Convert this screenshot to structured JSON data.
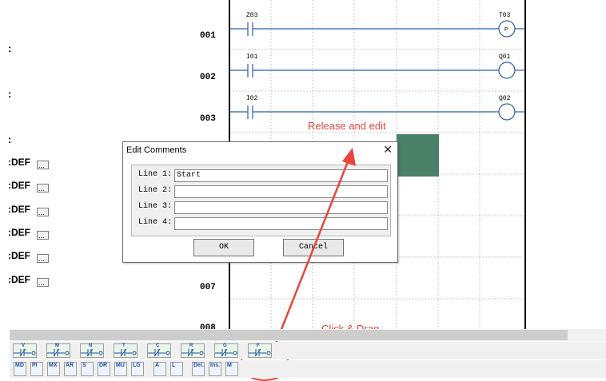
{
  "left_panel": {
    "items": [
      {
        "text": ":"
      },
      {
        "text": ":"
      },
      {
        "text": ":"
      },
      {
        "text": ":DEF"
      },
      {
        "text": ":DEF"
      },
      {
        "text": ":DEF"
      },
      {
        "text": ":DEF"
      },
      {
        "text": ":DEF"
      },
      {
        "text": ":DEF"
      }
    ],
    "dots_label": "..."
  },
  "ladder": {
    "rungs": [
      {
        "number": "001",
        "contact": "Z03",
        "coil": "T03",
        "coil_mark": "P"
      },
      {
        "number": "002",
        "contact": "I01",
        "coil": "Q01",
        "coil_mark": ""
      },
      {
        "number": "003",
        "contact": "I02",
        "coil": "Q02",
        "coil_mark": ""
      },
      {
        "number": "007"
      },
      {
        "number": "008"
      }
    ],
    "selection_color": "#4a7f68",
    "rail_color": "#000000",
    "wire_color": "#2a5db0"
  },
  "dialog": {
    "title": "Edit Comments",
    "close_glyph": "✕",
    "lines": [
      {
        "label": "Line 1:",
        "value": "Start"
      },
      {
        "label": "Line 2:",
        "value": ""
      },
      {
        "label": "Line 3:",
        "value": ""
      },
      {
        "label": "Line 4:",
        "value": ""
      }
    ],
    "ok_label": "OK",
    "cancel_label": "Cancel"
  },
  "toolbar_top": {
    "buttons": [
      {
        "letter": "V"
      },
      {
        "letter": "M"
      },
      {
        "letter": "N"
      },
      {
        "letter": "T"
      },
      {
        "letter": "C"
      },
      {
        "letter": "R"
      },
      {
        "letter": "G"
      },
      {
        "letter": "F"
      }
    ]
  },
  "toolbar_bottom": {
    "buttons": [
      {
        "label": "MD"
      },
      {
        "label": "PI"
      },
      {
        "label": "MX"
      },
      {
        "label": "AR"
      },
      {
        "label": "S"
      },
      {
        "label": "DR"
      },
      {
        "label": "MU"
      },
      {
        "label": "LG"
      },
      {
        "label": "A"
      },
      {
        "label": "L"
      },
      {
        "label": "Del."
      },
      {
        "label": "Ins."
      },
      {
        "label": "M"
      }
    ]
  },
  "annotations": {
    "release": "Release and edit",
    "drag": "Click & Drag",
    "color": "#e8453c"
  }
}
